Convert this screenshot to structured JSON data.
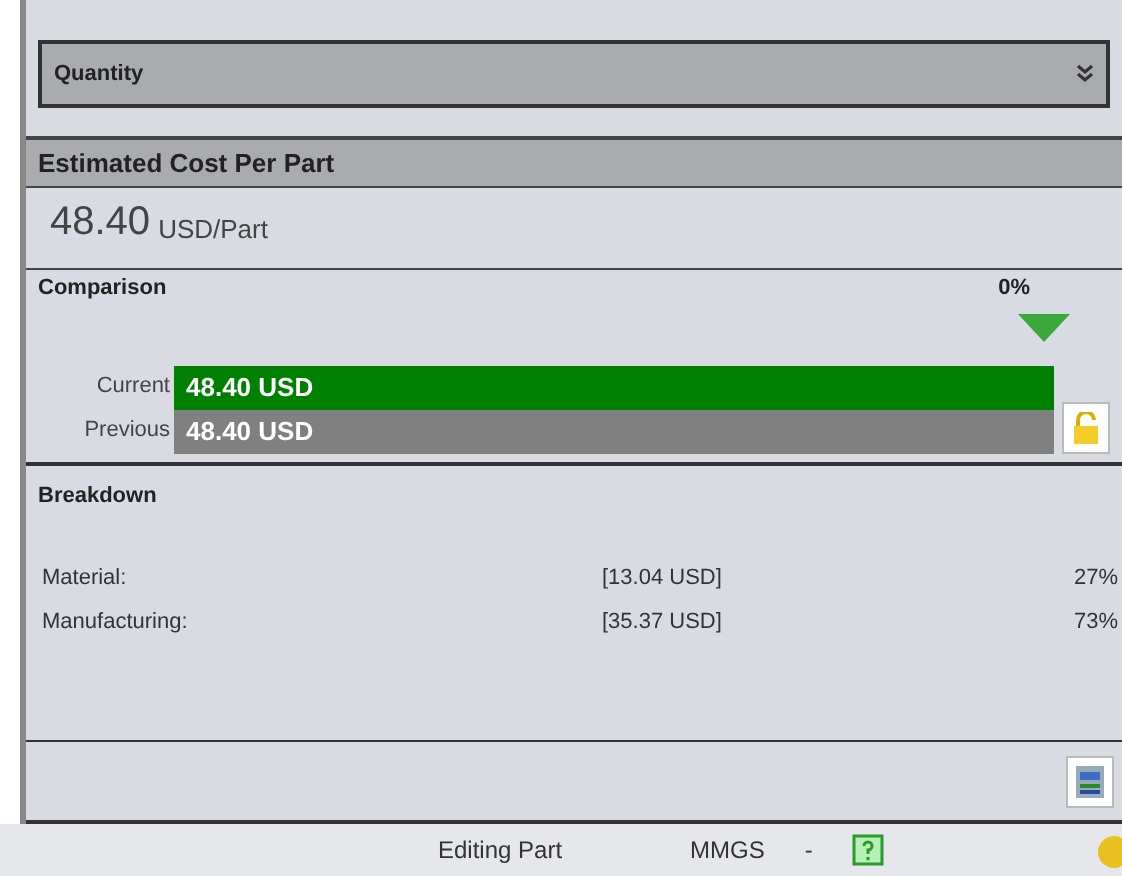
{
  "quantity": {
    "label": "Quantity",
    "expanded": false
  },
  "estimate": {
    "title": "Estimated Cost Per Part",
    "value": "48.40",
    "unit": "USD/Part"
  },
  "comparison": {
    "title": "Comparison",
    "change": "0%",
    "bars": [
      {
        "label": "Current",
        "value": "48.40 USD",
        "color": "#008000",
        "level": 1
      },
      {
        "label": "Previous",
        "value": "48.40 USD",
        "color": "#808080",
        "level": 1
      }
    ]
  },
  "breakdown": {
    "title": "Breakdown",
    "rows": [
      {
        "name": "Material:",
        "cost": "[13.04 USD]",
        "share": "27%"
      },
      {
        "name": "Manufacturing:",
        "cost": "[35.37 USD]",
        "share": "73%"
      }
    ]
  },
  "status_bar": {
    "mode": "Editing Part",
    "units": "MMGS",
    "separator": "-"
  }
}
